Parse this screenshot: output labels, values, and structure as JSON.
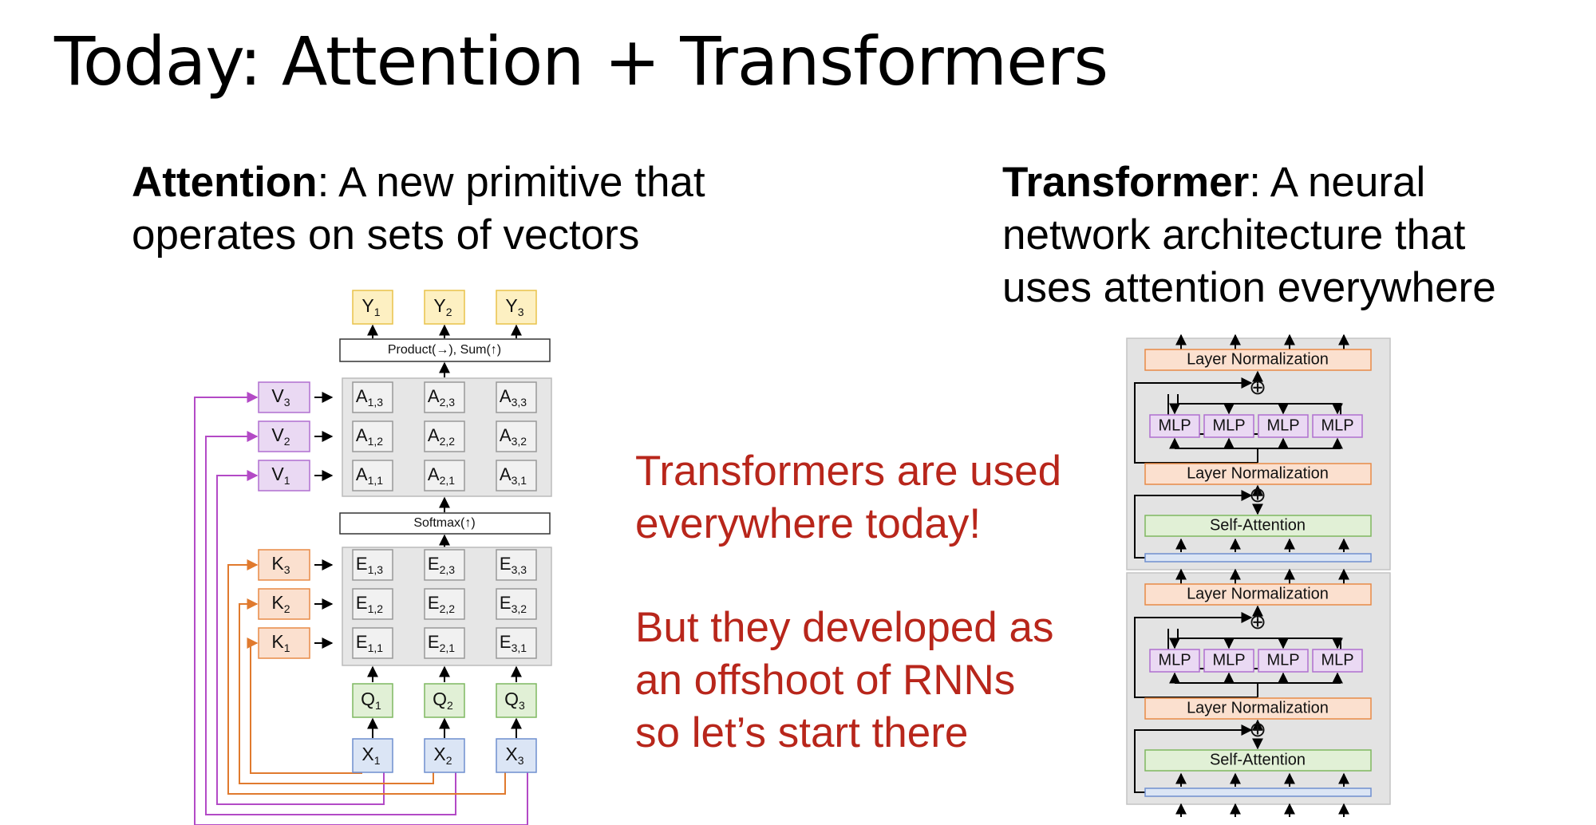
{
  "slide": {
    "title": "Today: Attention + Transformers"
  },
  "attention": {
    "term": "Attention",
    "desc_line1": ": A new primitive that",
    "desc_line2": "operates on sets of vectors",
    "outputs": [
      "Y",
      "Y",
      "Y"
    ],
    "output_subs": [
      "1",
      "2",
      "3"
    ],
    "product_label": "Product(→),  Sum(↑)",
    "softmax_label": "Softmax(↑)",
    "values": [
      "V",
      "V",
      "V"
    ],
    "value_subs": [
      "3",
      "2",
      "1"
    ],
    "keys": [
      "K",
      "K",
      "K"
    ],
    "key_subs": [
      "3",
      "2",
      "1"
    ],
    "queries": [
      "Q",
      "Q",
      "Q"
    ],
    "query_subs": [
      "1",
      "2",
      "3"
    ],
    "inputs": [
      "X",
      "X",
      "X"
    ],
    "input_subs": [
      "1",
      "2",
      "3"
    ],
    "a_letter": "A",
    "a_subs": [
      [
        "1,3",
        "2,3",
        "3,3"
      ],
      [
        "1,2",
        "2,2",
        "3,2"
      ],
      [
        "1,1",
        "2,1",
        "3,1"
      ]
    ],
    "e_letter": "E",
    "e_subs": [
      [
        "1,3",
        "2,3",
        "3,3"
      ],
      [
        "1,2",
        "2,2",
        "3,2"
      ],
      [
        "1,1",
        "2,1",
        "3,1"
      ]
    ]
  },
  "transformer": {
    "term": "Transformer",
    "desc_line1": ": A neural",
    "desc_line2": "network architecture that",
    "desc_line3": "uses attention everywhere",
    "layer_norm_label": "Layer Normalization",
    "mlp_label": "MLP",
    "self_attention_label": "Self-Attention",
    "residual_symbol": "⊕"
  },
  "notes": {
    "line1": "Transformers are used",
    "line2": "everywhere today!",
    "line3": "But they developed as",
    "line4": "an offshoot of RNNs",
    "line5": "so let’s start there"
  },
  "colors": {
    "red_text": "#b8261b",
    "y_fill": "#fdf0c2",
    "y_stroke": "#e9c24a",
    "v_fill": "#ead9f3",
    "v_stroke": "#b06fd0",
    "k_fill": "#fbe0cf",
    "k_stroke": "#e88a47",
    "q_fill": "#e1f0d6",
    "q_stroke": "#7fb860",
    "x_fill": "#dbe5f5",
    "x_stroke": "#6f8fcf",
    "purple_line": "#b34ac6",
    "orange_line": "#e07a2e"
  }
}
